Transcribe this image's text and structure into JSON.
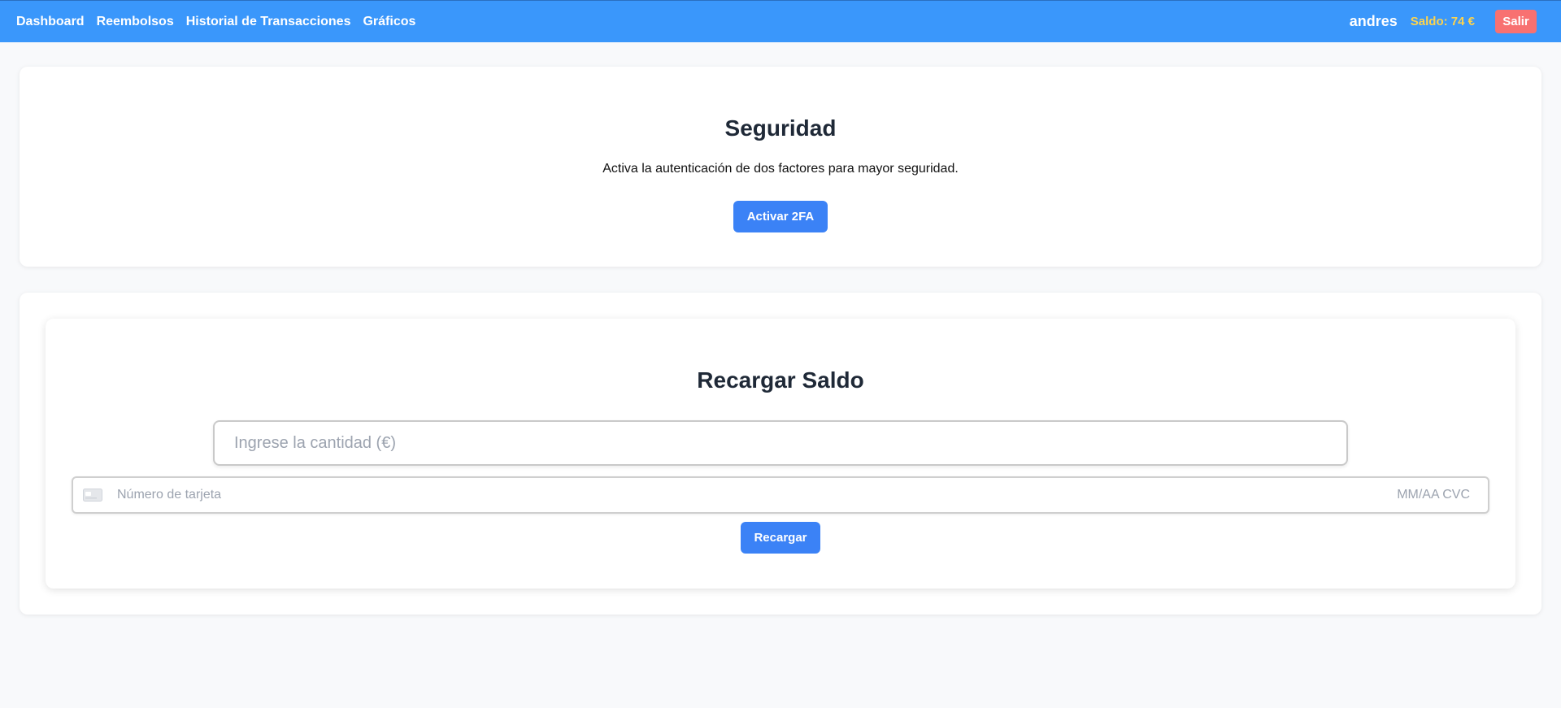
{
  "nav": {
    "links": [
      "Dashboard",
      "Reembolsos",
      "Historial de Transacciones",
      "Gráficos"
    ],
    "username": "andres",
    "balance": "Saldo: 74 €",
    "logout_label": "Salir"
  },
  "security": {
    "title": "Seguridad",
    "description": "Activa la autenticación de dos factores para mayor seguridad.",
    "button_label": "Activar 2FA"
  },
  "recharge": {
    "title": "Recargar Saldo",
    "amount_placeholder": "Ingrese la cantidad (€)",
    "card_number_placeholder": "Número de tarjeta",
    "expiry_cvc_placeholder": "MM/AA CVC",
    "button_label": "Recargar"
  },
  "colors": {
    "navbar": "#3a97fb",
    "balance": "#fcd34d",
    "logout": "#f87171",
    "primary_button": "#3b82f6"
  },
  "icons": {
    "card": "credit-card-icon"
  }
}
